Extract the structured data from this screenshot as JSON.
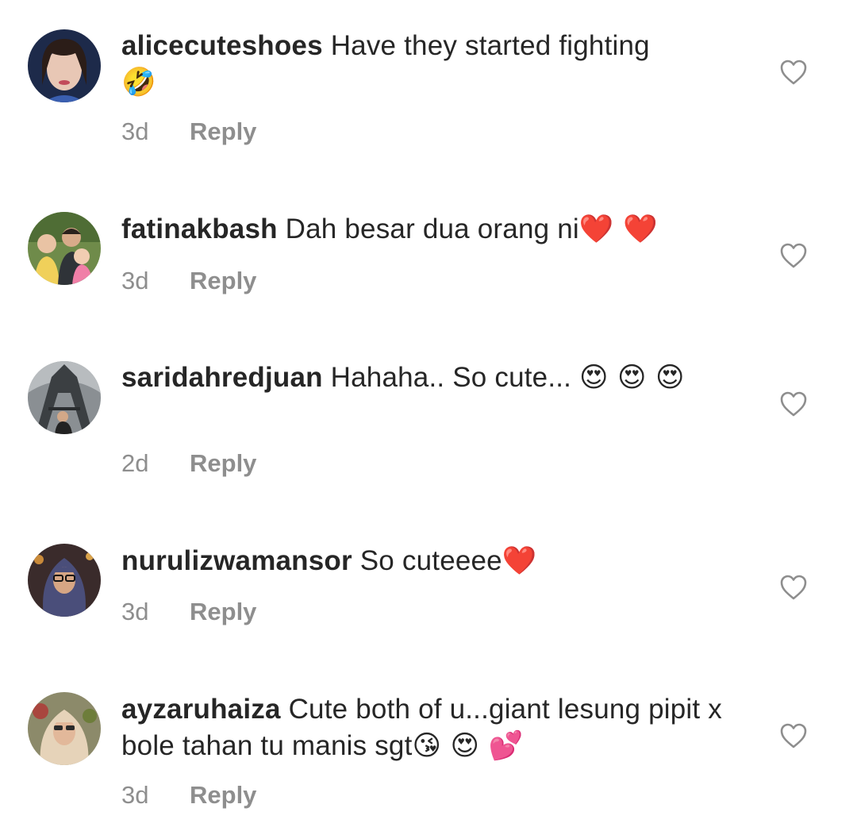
{
  "comments": [
    {
      "username": "alicecuteshoes",
      "text": "Have they started fighting",
      "emojis": "🤣",
      "time": "3d",
      "reply_label": "Reply"
    },
    {
      "username": "fatinakbash",
      "text": "Dah besar dua orang ni",
      "emojis": "❤️ ❤️",
      "time": "3d",
      "reply_label": "Reply"
    },
    {
      "username": "saridahredjuan",
      "text": "Hahaha.. So cute...",
      "emojis": "😍 😍 😍",
      "time": "2d",
      "reply_label": "Reply"
    },
    {
      "username": "nurulizwamansor",
      "text": "So cuteeee",
      "emojis": "❤️",
      "time": "3d",
      "reply_label": "Reply"
    },
    {
      "username": "ayzaruhaiza",
      "text": "Cute both of u...giant lesung pipit x bole tahan tu manis sgt",
      "emojis": "😘 😍 💕",
      "time": "3d",
      "reply_label": "Reply"
    }
  ],
  "icons": {
    "like": "heart-outline-icon"
  },
  "colors": {
    "text_primary": "#262626",
    "text_secondary": "#8e8e8e",
    "background": "#ffffff"
  }
}
